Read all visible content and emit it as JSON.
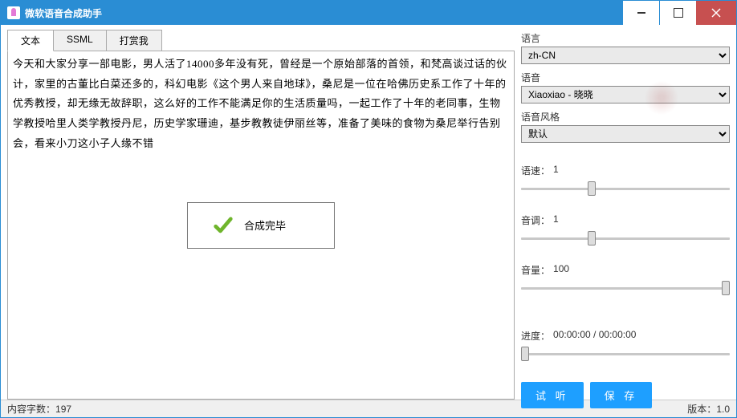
{
  "window": {
    "title": "微软语音合成助手"
  },
  "tabs": [
    {
      "label": "文本",
      "active": true
    },
    {
      "label": "SSML",
      "active": false
    },
    {
      "label": "打赏我",
      "active": false
    }
  ],
  "textarea": {
    "text": "今天和大家分享一部电影，男人活了14000多年没有死，曾经是一个原始部落的首领，和梵高谈过话的伙计，家里的古董比白菜还多的，科幻电影《这个男人来自地球》，桑尼是一位在哈佛历史系工作了十年的优秀教授，却无缘无故辞职，这么好的工作不能满足你的生活质量吗，一起工作了十年的老同事，生物学教授哈里人类学教授丹尼，历史学家珊迪，基步教教徒伊丽丝等，准备了美味的食物为桑尼举行告别会，看来小刀这小子人缘不错"
  },
  "toast": {
    "message": "合成完毕"
  },
  "panel": {
    "language": {
      "label": "语言",
      "value": "zh-CN"
    },
    "voice": {
      "label": "语音",
      "value": "Xiaoxiao - 晓晓"
    },
    "style": {
      "label": "语音风格",
      "value": "默认"
    },
    "speed": {
      "label": "语速：",
      "value": "1",
      "min": 0,
      "max": 3,
      "cur": 1
    },
    "pitch": {
      "label": "音调：",
      "value": "1",
      "min": 0,
      "max": 3,
      "cur": 1
    },
    "volume": {
      "label": "音量：",
      "value": "100",
      "min": 0,
      "max": 100,
      "cur": 100
    },
    "progress": {
      "label": "进度：",
      "value": "00:00:00 / 00:00:00",
      "min": 0,
      "max": 100,
      "cur": 0
    },
    "buttons": {
      "listen": "试 听",
      "save": "保 存"
    }
  },
  "statusbar": {
    "count_label": "内容字数：",
    "count_value": "197",
    "version_label": "版本：",
    "version_value": "1.0"
  }
}
